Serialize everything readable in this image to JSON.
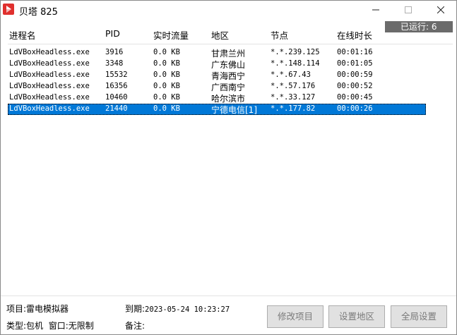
{
  "window": {
    "title": "贝塔 825",
    "icon": "beta-app-icon",
    "controls": [
      "minimize-icon",
      "maximize-icon",
      "close-icon"
    ]
  },
  "badge": {
    "running_label": "已运行: 6"
  },
  "table": {
    "headers": {
      "process": "进程名",
      "pid": "PID",
      "traffic": "实时流量",
      "region": "地区",
      "node": "节点",
      "online": "在线时长"
    },
    "rows": [
      {
        "process": "LdVBoxHeadless.exe",
        "pid": "3916",
        "traffic": "0.0 KB",
        "region": "甘肃兰州",
        "node": "*.*.239.125",
        "online": "00:01:16"
      },
      {
        "process": "LdVBoxHeadless.exe",
        "pid": "3348",
        "traffic": "0.0 KB",
        "region": "广东佛山",
        "node": "*.*.148.114",
        "online": "00:01:05"
      },
      {
        "process": "LdVBoxHeadless.exe",
        "pid": "15532",
        "traffic": "0.0 KB",
        "region": "青海西宁",
        "node": "*.*.67.43",
        "online": "00:00:59"
      },
      {
        "process": "LdVBoxHeadless.exe",
        "pid": "16356",
        "traffic": "0.0 KB",
        "region": "广西南宁",
        "node": "*.*.57.176",
        "online": "00:00:52"
      },
      {
        "process": "LdVBoxHeadless.exe",
        "pid": "10460",
        "traffic": "0.0 KB",
        "region": "哈尔滨市",
        "node": "*.*.33.127",
        "online": "00:00:45"
      },
      {
        "process": "LdVBoxHeadless.exe",
        "pid": "21440",
        "traffic": "0.0 KB",
        "region": "宁德电信[1]",
        "node": "*.*.177.82",
        "online": "00:00:26"
      }
    ],
    "selected_index": 5,
    "selection_color": "#0078d7"
  },
  "footer": {
    "project_label": "项目:",
    "project_value": "雷电模拟器",
    "expire_label": "到期:",
    "expire_value": "2023-05-24 10:23:27",
    "type_label": "类型:",
    "type_value": "包机",
    "window_label": "窗口:",
    "window_value": "无限制",
    "remark_label": "备注:",
    "buttons": {
      "edit_project": "修改项目",
      "set_region": "设置地区",
      "global_settings": "全局设置"
    }
  },
  "colors": {
    "badge_bg": "#6b6b6b",
    "app_icon": "#e0302e"
  }
}
